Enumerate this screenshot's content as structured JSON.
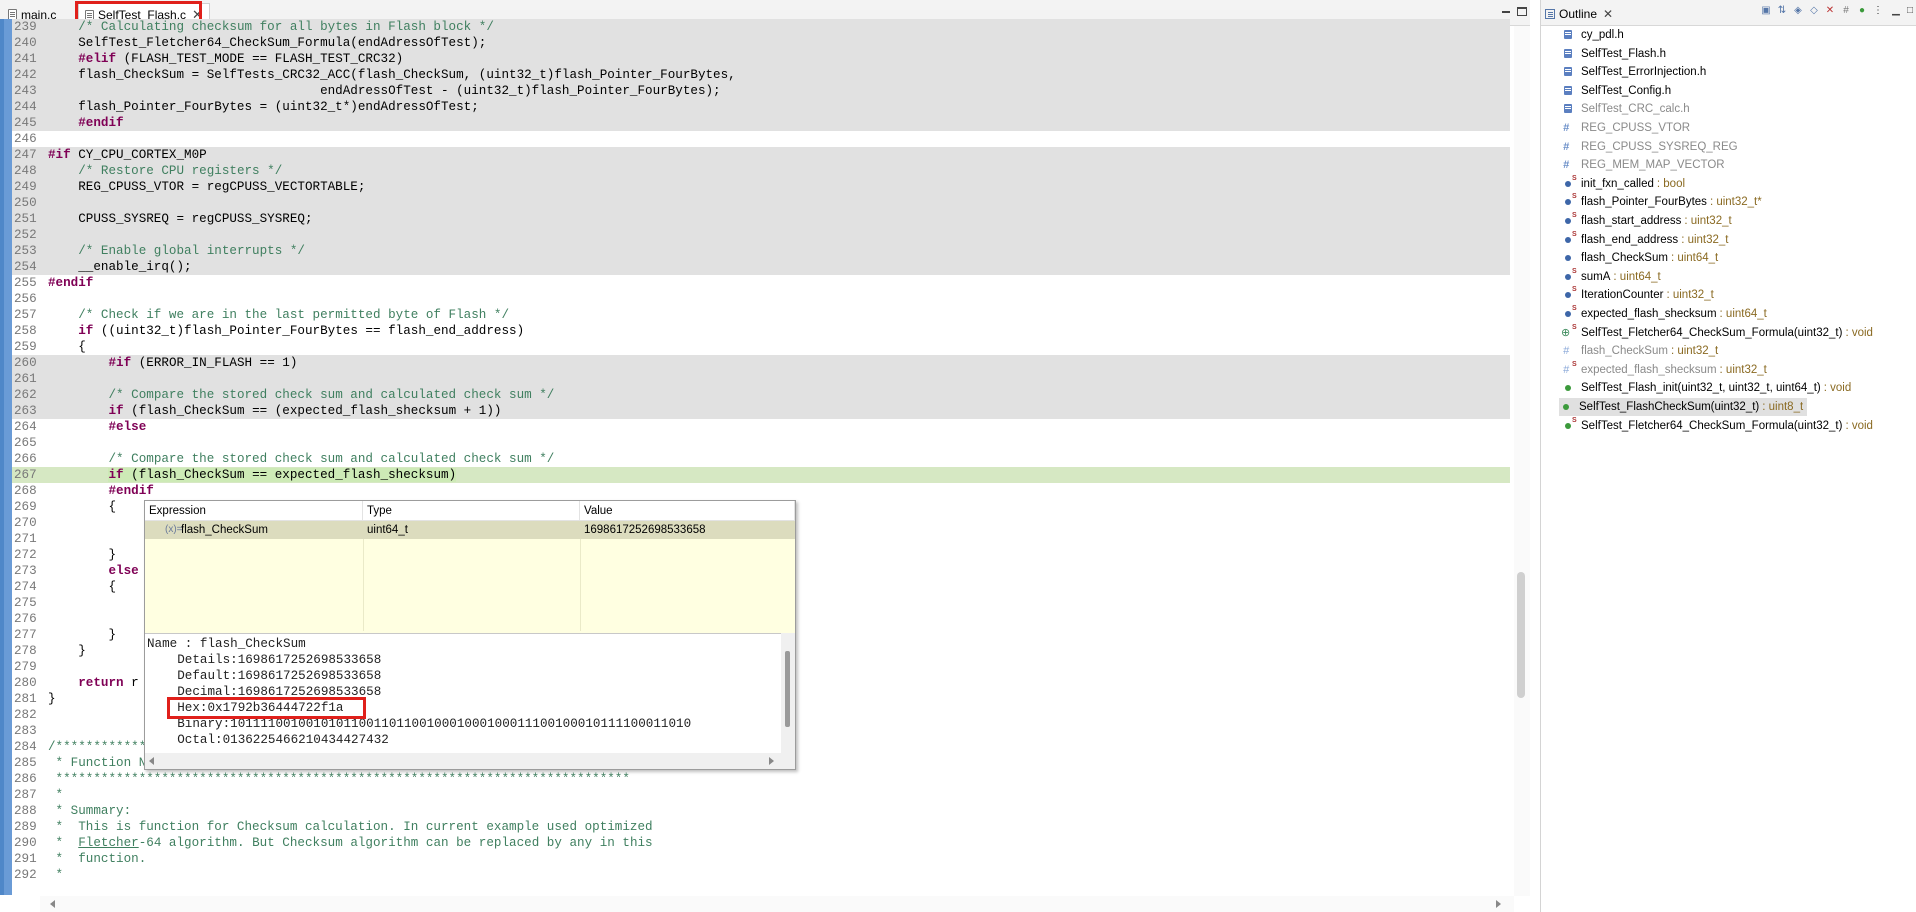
{
  "editor": {
    "tabs": [
      {
        "label": "main.c",
        "active": false
      },
      {
        "label": "SelfTest_Flash.c",
        "active": true,
        "close": "✕"
      }
    ],
    "lines": [
      {
        "n": "239",
        "html": "    <span class=\"cm\">/* Calculating checksum for all bytes in Flash block */</span>",
        "inactive": true
      },
      {
        "n": "240",
        "html": "    SelfTest_Fletcher64_CheckSum_Formula(endAdressOfTest);",
        "inactive": true
      },
      {
        "n": "241",
        "html": "    <span class=\"kw\">#elif</span> (FLASH_TEST_MODE == FLASH_TEST_CRC32)",
        "inactive": true
      },
      {
        "n": "242",
        "html": "    flash_CheckSum = SelfTests_CRC32_ACC(flash_CheckSum, (uint32_t)flash_Pointer_FourBytes,",
        "inactive": true
      },
      {
        "n": "243",
        "html": "                                    endAdressOfTest - (uint32_t)flash_Pointer_FourBytes);",
        "inactive": true
      },
      {
        "n": "244",
        "html": "    flash_Pointer_FourBytes = (uint32_t*)endAdressOfTest;",
        "inactive": true
      },
      {
        "n": "245",
        "html": "    <span class=\"kw\">#endif</span>",
        "inactive": true
      },
      {
        "n": "246",
        "html": "",
        "inactive": false
      },
      {
        "n": "247",
        "html": "<span class=\"kw\">#if</span> CY_CPU_CORTEX_M0P",
        "inactive": true
      },
      {
        "n": "248",
        "html": "    <span class=\"cm\">/* Restore CPU registers */</span>",
        "inactive": true
      },
      {
        "n": "249",
        "html": "    REG_CPUSS_VTOR = regCPUSS_VECTORTABLE;",
        "inactive": true
      },
      {
        "n": "250",
        "html": "",
        "inactive": true
      },
      {
        "n": "251",
        "html": "    CPUSS_SYSREQ = regCPUSS_SYSREQ;",
        "inactive": true
      },
      {
        "n": "252",
        "html": "",
        "inactive": true
      },
      {
        "n": "253",
        "html": "    <span class=\"cm\">/* Enable global interrupts */</span>",
        "inactive": true
      },
      {
        "n": "254",
        "html": "    __enable_irq();",
        "inactive": true
      },
      {
        "n": "255",
        "html": "<span class=\"kw\">#endif</span>",
        "inactive": false
      },
      {
        "n": "256",
        "html": "",
        "inactive": false
      },
      {
        "n": "257",
        "html": "    <span class=\"cm\">/* Check if we are in the last permitted byte of Flash */</span>",
        "inactive": false
      },
      {
        "n": "258",
        "html": "    <span class=\"kw\">if</span> ((uint32_t)flash_Pointer_FourBytes == flash_end_address)",
        "inactive": false
      },
      {
        "n": "259",
        "html": "    {",
        "inactive": false
      },
      {
        "n": "260",
        "html": "        <span class=\"kw\">#if</span> (ERROR_IN_FLASH == 1)",
        "inactive": true
      },
      {
        "n": "261",
        "html": "",
        "inactive": true
      },
      {
        "n": "262",
        "html": "        <span class=\"cm\">/* Compare the stored check sum and calculated check sum */</span>",
        "inactive": true
      },
      {
        "n": "263",
        "html": "        <span class=\"kw\">if</span> (flash_CheckSum == (expected_flash_shecksum + 1))",
        "inactive": true
      },
      {
        "n": "264",
        "html": "        <span class=\"kw\">#else</span>",
        "inactive": false
      },
      {
        "n": "265",
        "html": "",
        "inactive": false
      },
      {
        "n": "266",
        "html": "        <span class=\"cm\">/* Compare the stored check sum and calculated check sum */</span>",
        "inactive": false
      },
      {
        "n": "267",
        "html": "        <span class=\"cur-ref\"><span class=\"kw\">if</span> (flash_CheckSum == expected_flash_shecksum)</span>",
        "inactive": false,
        "current": true
      },
      {
        "n": "268",
        "html": "        <span class=\"kw\">#endif</span>",
        "inactive": false
      },
      {
        "n": "269",
        "html": "        {",
        "inactive": false
      },
      {
        "n": "270",
        "html": "",
        "inactive": false
      },
      {
        "n": "271",
        "html": "",
        "inactive": false
      },
      {
        "n": "272",
        "html": "        }",
        "inactive": false
      },
      {
        "n": "273",
        "html": "        <span class=\"kw\">else</span>",
        "inactive": false
      },
      {
        "n": "274",
        "html": "        {",
        "inactive": false
      },
      {
        "n": "275",
        "html": "",
        "inactive": false
      },
      {
        "n": "276",
        "html": "",
        "inactive": false
      },
      {
        "n": "277",
        "html": "        }",
        "inactive": false
      },
      {
        "n": "278",
        "html": "    }",
        "inactive": false
      },
      {
        "n": "279",
        "html": "",
        "inactive": false
      },
      {
        "n": "280",
        "html": "    <span class=\"kw\">return</span> r",
        "inactive": false
      },
      {
        "n": "281",
        "html": "}",
        "inactive": false
      },
      {
        "n": "282",
        "html": "",
        "inactive": false
      },
      {
        "n": "283",
        "html": "",
        "inactive": false
      },
      {
        "n": "284",
        "html": "<span class=\"cm\">/*************</span>",
        "inactive": false
      },
      {
        "n": "285",
        "html": "<span class=\"cm\"> * Function Name: SelfTest_Fletcher64_CheckSum_Formula()</span>",
        "inactive": false
      },
      {
        "n": "286",
        "html": "<span class=\"cm\"> ****************************************************************************</span>",
        "inactive": false
      },
      {
        "n": "287",
        "html": "<span class=\"cm\"> *</span>",
        "inactive": false
      },
      {
        "n": "288",
        "html": "<span class=\"cm\"> * Summary:</span>",
        "inactive": false
      },
      {
        "n": "289",
        "html": "<span class=\"cm\"> *  This is function for Checksum calculation. In current example used optimized</span>",
        "inactive": false
      },
      {
        "n": "290",
        "html": "<span class=\"cm\"> *  <span class=\"ul\">Fletcher</span>-64 algorithm. But Checksum algorithm can be replaced by any in this</span>",
        "inactive": false
      },
      {
        "n": "291",
        "html": "<span class=\"cm\"> *  function.</span>",
        "inactive": false
      },
      {
        "n": "292",
        "html": "<span class=\"cm\"> *</span>",
        "inactive": false
      }
    ]
  },
  "hover": {
    "headers": {
      "expression": "Expression",
      "type": "Type",
      "value": "Value"
    },
    "row": {
      "expression": "flash_CheckSum",
      "type": "uint64_t",
      "value": "1698617252698533658",
      "icon": "(x)="
    },
    "details": [
      "Name : flash_CheckSum",
      "    Details:1698617252698533658",
      "    Default:1698617252698533658",
      "    Decimal:1698617252698533658",
      "    Hex:0x1792b36444722f1a",
      "    Binary:1011110010010101100110110010001000100011100100010111100011010",
      "    Octal:0136225466210434427432"
    ]
  },
  "outline": {
    "title": "Outline",
    "close": "✕",
    "items": [
      {
        "icon": "ic-include",
        "name": "cy_pdl.h",
        "type": "",
        "dim": false
      },
      {
        "icon": "ic-include",
        "name": "SelfTest_Flash.h",
        "type": "",
        "dim": false
      },
      {
        "icon": "ic-include",
        "name": "SelfTest_ErrorInjection.h",
        "type": "",
        "dim": false
      },
      {
        "icon": "ic-include",
        "name": "SelfTest_Config.h",
        "type": "",
        "dim": false
      },
      {
        "icon": "ic-include",
        "name": "SelfTest_CRC_calc.h",
        "type": "",
        "dim": true
      },
      {
        "icon": "ic-macro",
        "name": "REG_CPUSS_VTOR",
        "type": "",
        "dim": true
      },
      {
        "icon": "ic-macro",
        "name": "REG_CPUSS_SYSREQ_REG",
        "type": "",
        "dim": true
      },
      {
        "icon": "ic-macro",
        "name": "REG_MEM_MAP_VECTOR",
        "type": "",
        "dim": true
      },
      {
        "icon": "ic-field ic-s",
        "name": "init_fxn_called",
        "type": ": bool",
        "dim": false
      },
      {
        "icon": "ic-field ic-s",
        "name": "flash_Pointer_FourBytes",
        "type": ": uint32_t*",
        "dim": false
      },
      {
        "icon": "ic-field ic-s",
        "name": "flash_start_address",
        "type": ": uint32_t",
        "dim": false
      },
      {
        "icon": "ic-field ic-s",
        "name": "flash_end_address",
        "type": ": uint32_t",
        "dim": false
      },
      {
        "icon": "ic-field",
        "name": "flash_CheckSum",
        "type": ": uint64_t",
        "dim": false
      },
      {
        "icon": "ic-field ic-s",
        "name": "sumA",
        "type": ": uint64_t",
        "dim": false
      },
      {
        "icon": "ic-field ic-s",
        "name": "IterationCounter",
        "type": ": uint32_t",
        "dim": false
      },
      {
        "icon": "ic-field ic-s",
        "name": "expected_flash_shecksum",
        "type": ": uint64_t",
        "dim": false
      },
      {
        "icon": "ic-fn-decl ic-s",
        "name": "SelfTest_Fletcher64_CheckSum_Formula(uint32_t)",
        "type": ": void",
        "dim": false
      },
      {
        "icon": "ic-dimfield",
        "name": "flash_CheckSum",
        "type": ": uint32_t",
        "dim": true
      },
      {
        "icon": "ic-dimfield ic-s",
        "name": "expected_flash_shecksum",
        "type": ": uint32_t",
        "dim": true
      },
      {
        "icon": "ic-fn-green",
        "name": "SelfTest_Flash_init(uint32_t, uint32_t, uint64_t)",
        "type": ": void",
        "dim": false
      },
      {
        "icon": "ic-fn-green",
        "name": "SelfTest_FlashCheckSum(uint32_t)",
        "type": ": uint8_t",
        "dim": false,
        "selected": true
      },
      {
        "icon": "ic-fn-green ic-s",
        "name": "SelfTest_Fletcher64_CheckSum_Formula(uint32_t)",
        "type": ": void",
        "dim": false
      }
    ]
  }
}
